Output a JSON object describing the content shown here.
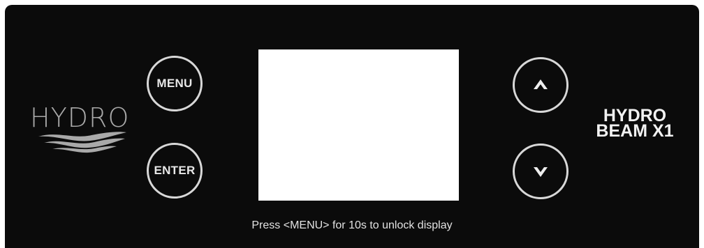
{
  "brand": {
    "name": "HYDRO",
    "logo_icon": "waves-icon"
  },
  "buttons": {
    "menu_label": "MENU",
    "enter_label": "ENTER",
    "up_icon": "chevron-up-icon",
    "down_icon": "chevron-down-icon"
  },
  "display": {
    "content": ""
  },
  "model": {
    "line1": "HYDRO",
    "line2": "BEAM X1"
  },
  "hint": "Press <MENU> for 10s to unlock display",
  "colors": {
    "panel": "#0b0b0b",
    "button_ring": "#d8d8d8",
    "brand_gray": "#a9a9a9",
    "screen": "#ffffff"
  }
}
